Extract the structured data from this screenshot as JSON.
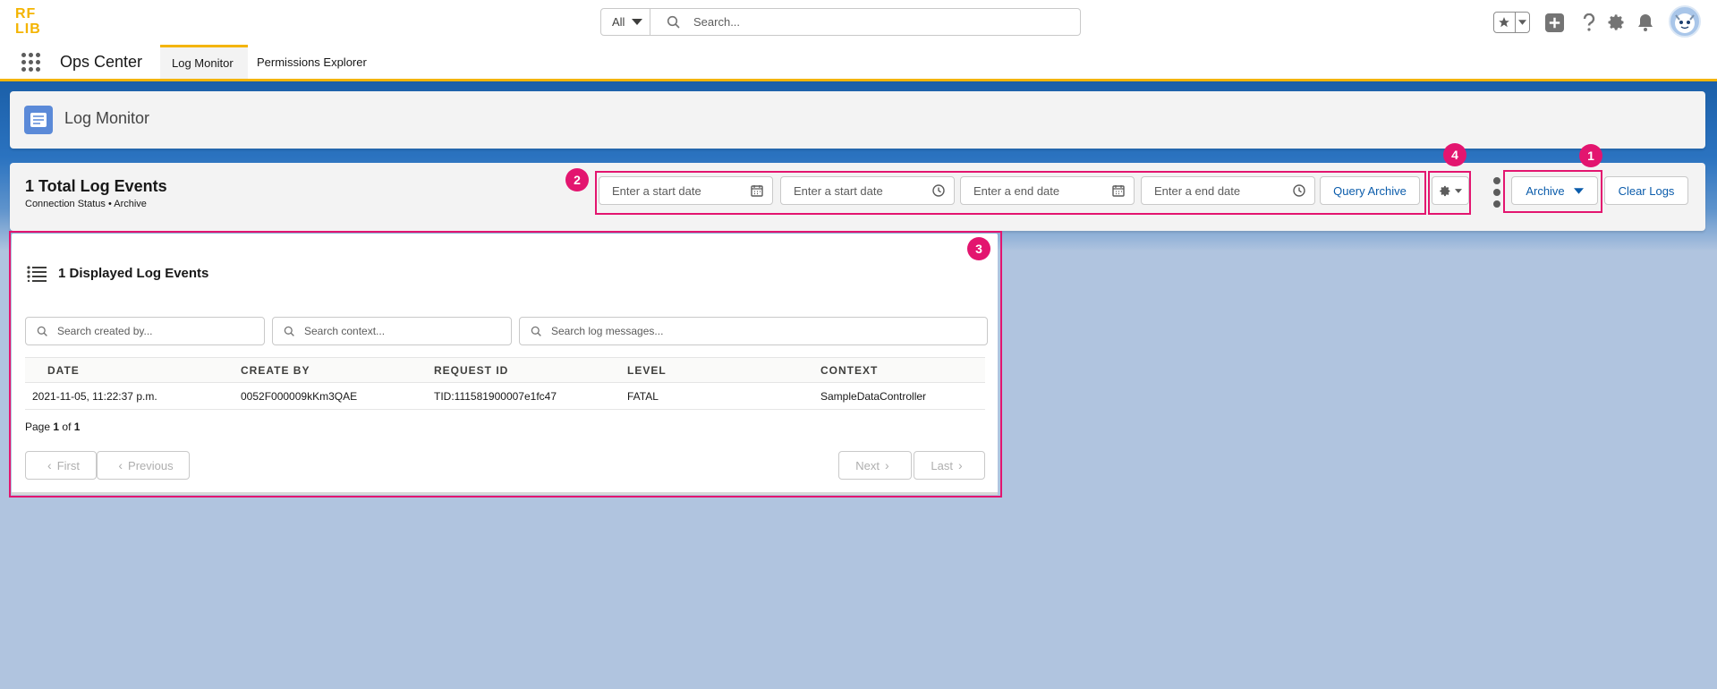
{
  "brand": {
    "logo_top": "RF",
    "logo_bottom": "LIB",
    "accent": "#f4b400"
  },
  "global_search": {
    "scope": "All",
    "placeholder": "Search..."
  },
  "header_icons": [
    "favorites-star-icon",
    "favorites-dropdown-icon",
    "add-icon",
    "help-icon",
    "setup-gear-icon",
    "notifications-bell-icon",
    "avatar"
  ],
  "app_nav": {
    "app_name": "Ops Center",
    "tabs": [
      {
        "label": "Log Monitor",
        "active": true
      },
      {
        "label": "Permissions Explorer",
        "active": false
      }
    ]
  },
  "page_header": {
    "title": "Log Monitor"
  },
  "toolbar": {
    "total": "1 Total Log Events",
    "connection": "Connection Status • Archive",
    "start_date_placeholder": "Enter a start date",
    "start_time_placeholder": "Enter a start date",
    "end_date_placeholder": "Enter a end date",
    "end_time_placeholder": "Enter a end date",
    "query_label": "Query Archive",
    "archive_label": "Archive",
    "clear_label": "Clear Logs"
  },
  "callouts": {
    "c1": "1",
    "c2": "2",
    "c3": "3",
    "c4": "4",
    "color": "#e3156f"
  },
  "events": {
    "title": "1 Displayed Log Events",
    "search_created_by": "Search created by...",
    "search_context": "Search context...",
    "search_messages": "Search log messages...",
    "columns": [
      "DATE",
      "CREATE BY",
      "REQUEST ID",
      "LEVEL",
      "CONTEXT"
    ],
    "rows": [
      [
        "2021-11-05, 11:22:37 p.m.",
        "0052F000009kKm3QAE",
        "TID:111581900007e1fc47",
        "FATAL",
        "SampleDataController"
      ]
    ],
    "page_prefix": "Page",
    "page_current": "1",
    "page_of": "of",
    "page_total": "1",
    "first_label": "First",
    "previous_label": "Previous",
    "next_label": "Next",
    "last_label": "Last"
  }
}
